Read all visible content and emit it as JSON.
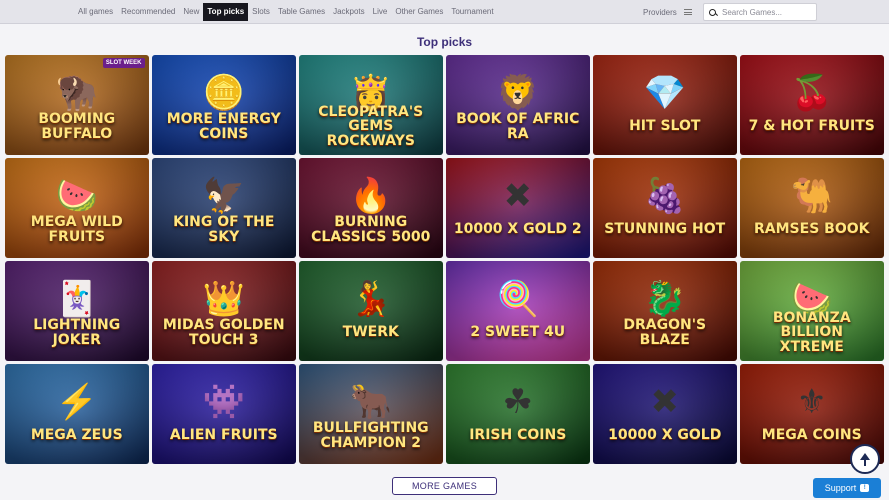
{
  "nav": {
    "items": [
      {
        "label": "All games",
        "active": false
      },
      {
        "label": "Recommended",
        "active": false
      },
      {
        "label": "New",
        "active": false
      },
      {
        "label": "Top picks",
        "active": true
      },
      {
        "label": "Slots",
        "active": false
      },
      {
        "label": "Table Games",
        "active": false
      },
      {
        "label": "Jackpots",
        "active": false
      },
      {
        "label": "Live",
        "active": false
      },
      {
        "label": "Other Games",
        "active": false
      },
      {
        "label": "Tournament",
        "active": false
      }
    ],
    "providers_label": "Providers",
    "providers_icon": "menu-icon"
  },
  "search": {
    "placeholder": "Search Games...",
    "value": "",
    "icon": "search-icon"
  },
  "section_title": "Top picks",
  "games": [
    {
      "title": "Booming Buffalo",
      "badge": "SLOT WEEK",
      "art": "🦬",
      "bg": [
        "#e0902a",
        "#7a3a10"
      ]
    },
    {
      "title": "More Energy Coins",
      "art": "🪙",
      "bg": [
        "#1a5fe0",
        "#0a1f6e"
      ]
    },
    {
      "title": "Cleopatra's Gems Rockways",
      "art": "👸",
      "bg": [
        "#2aa5a0",
        "#0f3f45"
      ]
    },
    {
      "title": "Book of Afric Ra",
      "art": "🦁",
      "bg": [
        "#7a3ab8",
        "#24124a"
      ]
    },
    {
      "title": "Hit Slot",
      "art": "💎",
      "bg": [
        "#c83018",
        "#4a0b06"
      ]
    },
    {
      "title": "7 & Hot Fruits",
      "art": "🍒",
      "bg": [
        "#c8141e",
        "#4a0508"
      ]
    },
    {
      "title": "Mega Wild Fruits",
      "art": "🍉",
      "bg": [
        "#f08a1c",
        "#8a3008"
      ]
    },
    {
      "title": "King of the Sky",
      "art": "🦅",
      "bg": [
        "#3a5a9a",
        "#0e1a38"
      ]
    },
    {
      "title": "Burning Classics 5000",
      "art": "🔥",
      "bg": [
        "#8a1a40",
        "#2a0514"
      ]
    },
    {
      "title": "10000 X Gold 2",
      "art": "✖",
      "bg": [
        "#c01820",
        "#1a1a8a"
      ]
    },
    {
      "title": "Stunning Hot",
      "art": "🍇",
      "bg": [
        "#d0480a",
        "#5a0a06"
      ]
    },
    {
      "title": "Ramses Book",
      "art": "🐫",
      "bg": [
        "#e08018",
        "#6a2a08"
      ]
    },
    {
      "title": "Lightning Joker",
      "art": "🃏",
      "bg": [
        "#6a2a8a",
        "#200a30"
      ]
    },
    {
      "title": "Midas Golden Touch 3",
      "art": "👑",
      "bg": [
        "#b02a2a",
        "#3a0a10"
      ]
    },
    {
      "title": "Twerk",
      "art": "💃",
      "bg": [
        "#2a7a3a",
        "#0a2a14"
      ]
    },
    {
      "title": "2 Sweet 4U",
      "art": "🍭",
      "bg": [
        "#7a3ad0",
        "#d03a9a"
      ]
    },
    {
      "title": "Dragon's Blaze",
      "art": "🐉",
      "bg": [
        "#c03a0a",
        "#4a0a04"
      ]
    },
    {
      "title": "Bonanza Billion Xtreme",
      "art": "🍉",
      "bg": [
        "#8ad04a",
        "#2a7a2a"
      ]
    },
    {
      "title": "Mega Zeus",
      "art": "⚡",
      "bg": [
        "#3a8ad0",
        "#0e2a5a"
      ]
    },
    {
      "title": "Alien Fruits",
      "art": "👾",
      "bg": [
        "#3a2ad0",
        "#12085a"
      ]
    },
    {
      "title": "Bullfighting Champion 2",
      "art": "🐂",
      "bg": [
        "#3a6a9a",
        "#7a3010"
      ]
    },
    {
      "title": "Irish Coins",
      "art": "☘",
      "bg": [
        "#3a9a3a",
        "#0a3a14"
      ]
    },
    {
      "title": "10000 X Gold",
      "art": "✖",
      "bg": [
        "#2a1a9a",
        "#0a0a3a"
      ]
    },
    {
      "title": "Mega Coins",
      "art": "⚜",
      "bg": [
        "#c0260a",
        "#4a0604"
      ]
    }
  ],
  "more_games_label": "MORE GAMES",
  "support_label": "Support",
  "scroll_top_icon": "arrow-up-icon"
}
